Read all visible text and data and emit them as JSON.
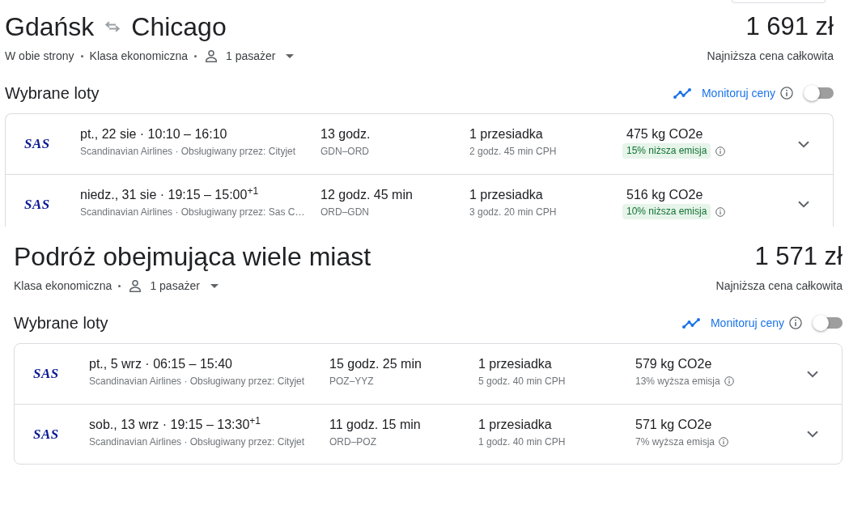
{
  "panels": [
    {
      "kind": "round_trip",
      "origin": "Gdańsk",
      "destination": "Chicago",
      "price": "1 691 zł",
      "details": [
        "W obie strony",
        "Klasa ekonomiczna"
      ],
      "passengers": "1 pasażer",
      "price_note": "Najniższa cena całkowita",
      "section_title": "Wybrane loty",
      "price_tracking": {
        "label": "Monitoruj ceny",
        "on": false
      },
      "flights": [
        {
          "logo": "SAS",
          "summary": "pt., 22 sie · 10:10 – 16:10",
          "carrier": "Scandinavian Airlines · Obsługiwany przez: Cityjet",
          "duration": "13 godz.",
          "route": "GDN–ORD",
          "stops": "1 przesiadka",
          "layover": "2 godz. 45 min CPH",
          "emissions": "475 kg CO2e",
          "emission_change": {
            "kind": "lower",
            "text": "15% niższa emisja"
          },
          "expanded": false
        },
        {
          "logo": "SAS",
          "summary": "niedz., 31 sie · 19:15 – 15:00$^{+1}$",
          "carrier": "Scandinavian Airlines · Obsługiwany przez: Sas C…",
          "duration": "12 godz. 45 min",
          "route": "ORD–GDN",
          "stops": "1 przesiadka",
          "layover": "3 godz. 20 min CPH",
          "emissions": "516 kg CO2e",
          "emission_change": {
            "kind": "lower",
            "text": "10% niższa emisja"
          },
          "expanded": false
        }
      ]
    },
    {
      "kind": "multi_city",
      "title": "Podróż obejmująca wiele miast",
      "price": "1 571 zł",
      "details": [
        "Klasa ekonomiczna"
      ],
      "passengers": "1 pasażer",
      "price_note": "Najniższa cena całkowita",
      "section_title": "Wybrane loty",
      "price_tracking": {
        "label": "Monitoruj ceny",
        "on": false
      },
      "flights": [
        {
          "logo": "SAS",
          "summary": "pt., 5 wrz · 06:15 – 15:40",
          "carrier": "Scandinavian Airlines · Obsługiwany przez: Cityjet",
          "duration": "15 godz. 25 min",
          "route": "POZ–YYZ",
          "stops": "1 przesiadka",
          "layover": "5 godz. 40 min CPH",
          "emissions": "579 kg CO2e",
          "emission_change": {
            "kind": "higher",
            "text": "13% wyższa emisja"
          },
          "expanded": false
        },
        {
          "logo": "SAS",
          "summary": "sob., 13 wrz · 19:15 – 13:30$^{+1}$",
          "carrier": "Scandinavian Airlines · Obsługiwany przez: Cityjet",
          "duration": "11 godz. 15 min",
          "route": "ORD–POZ",
          "stops": "1 przesiadka",
          "layover": "1 godz. 40 min CPH",
          "emissions": "571 kg CO2e",
          "emission_change": {
            "kind": "higher",
            "text": "7% wyższa emisja"
          },
          "expanded": false
        }
      ]
    }
  ]
}
